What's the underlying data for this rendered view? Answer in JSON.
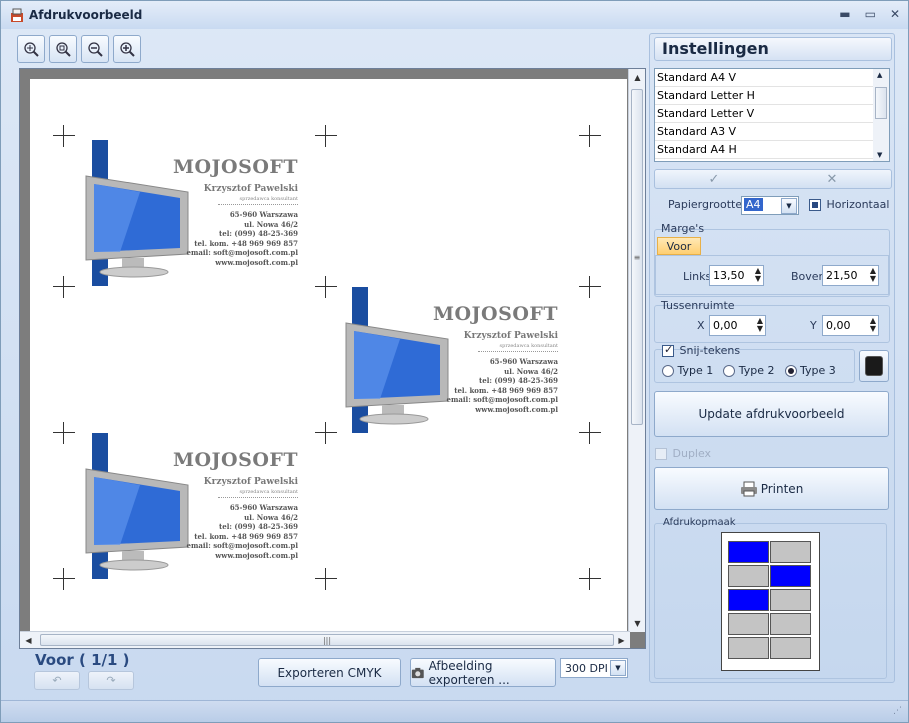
{
  "window": {
    "title": "Afdrukvoorbeeld",
    "minimize": "▬",
    "maximize": "▭",
    "close": "✕"
  },
  "toolbar": {
    "zoom_fit_icon": "zoom-fit-icon",
    "zoom_page_icon": "zoom-page-icon",
    "zoom_out_icon": "zoom-out-icon",
    "zoom_in_icon": "zoom-in-icon"
  },
  "card": {
    "brand": "MOJOSOFT",
    "name": "Krzysztof Pawelski",
    "role": "sprzedawca konsultant",
    "address_lines": [
      "65-960 Warszawa",
      "ul. Nowa 46/2",
      "tel: (099) 48-25-369",
      "tel. kom. +48 969 969 857",
      "email: soft@mojosoft.com.pl",
      "www.mojosoft.com.pl"
    ]
  },
  "footer": {
    "page_label": "Voor ( 1/1 )",
    "export_cmyk": "Exporteren CMYK",
    "export_image": "Afbeelding exporteren ...",
    "dpi": "300 DPI"
  },
  "settings": {
    "title": "Instellingen",
    "presets": [
      "Standard A4 V",
      "Standard Letter H",
      "Standard Letter V",
      "Standard A3 V",
      "Standard A4 H"
    ],
    "confirm": "✓",
    "cancel": "✕",
    "paper_label": "Papiergrootte",
    "paper_value": "A4",
    "horizontal_label": "Horizontaal",
    "margins_title": "Marge's",
    "margins_tab": "Voor",
    "left_label": "Links",
    "left_value": "13,50",
    "top_label": "Boven",
    "top_value": "21,50",
    "spacing_title": "Tussenruimte",
    "x_label": "X",
    "x_value": "0,00",
    "y_label": "Y",
    "y_value": "0,00",
    "cutmarks_label": "Snij-tekens",
    "type1": "Type 1",
    "type2": "Type 2",
    "type3": "Type 3",
    "update_button": "Update afdrukvoorbeeld",
    "duplex_label": "Duplex",
    "print_button": "Printen",
    "layout_title": "Afdrukopmaak",
    "layout_cells": [
      1,
      0,
      0,
      1,
      1,
      0,
      0,
      0,
      0,
      0
    ]
  },
  "colors": {
    "accent": "#1a4da0",
    "layout_on": "#0000ff",
    "layout_off": "#c4c4c4"
  }
}
